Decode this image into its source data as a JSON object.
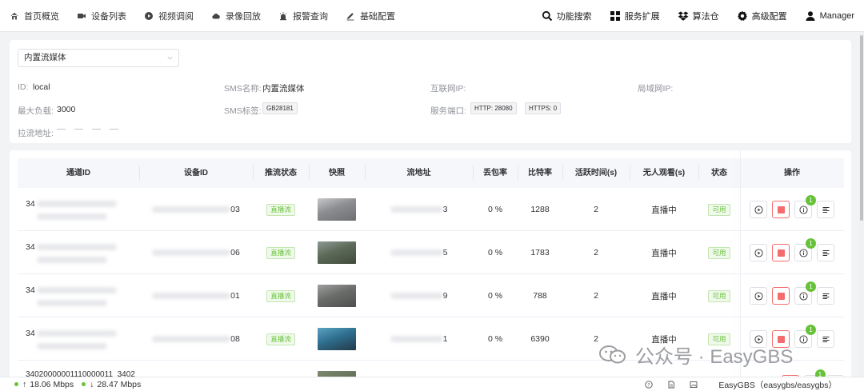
{
  "nav": {
    "left": [
      {
        "label": "首页概览",
        "icon": "home-icon"
      },
      {
        "label": "设备列表",
        "icon": "video-camera-icon"
      },
      {
        "label": "视频调阅",
        "icon": "play-circle-icon"
      },
      {
        "label": "录像回放",
        "icon": "cloud-icon"
      },
      {
        "label": "报警查询",
        "icon": "alarm-icon"
      },
      {
        "label": "基础配置",
        "icon": "edit-icon"
      }
    ],
    "right": [
      {
        "label": "功能搜索",
        "icon": "search-icon"
      },
      {
        "label": "服务扩展",
        "icon": "grid-icon"
      },
      {
        "label": "算法仓",
        "icon": "dropbox-icon"
      },
      {
        "label": "高级配置",
        "icon": "gear-icon"
      },
      {
        "label": "Manager",
        "icon": "user-icon"
      }
    ]
  },
  "server": {
    "selected": "内置流媒体",
    "id_label": "ID:",
    "id_value": "local",
    "sms_name_label": "SMS名称:",
    "sms_name_value": "内置流媒体",
    "public_ip_label": "互联网IP:",
    "lan_ip_label": "局域网IP:",
    "max_load_label": "最大负载:",
    "max_load_value": "3000",
    "sms_tag_label": "SMS标签:",
    "sms_tag_value": "GB28181",
    "port_label": "服务端口:",
    "http_port": "HTTP: 28080",
    "https_port": "HTTPS: 0",
    "pull_addr_label": "拉流地址:"
  },
  "table": {
    "headers": [
      "通道ID",
      "设备ID",
      "推流状态",
      "快照",
      "流地址",
      "丢包率",
      "比特率",
      "活跃时间(s)",
      "无人观看(s)",
      "状态",
      "操作"
    ],
    "rows": [
      {
        "channel_prefix": "34",
        "device_suffix": "03",
        "push_status": "直播流",
        "stream_suffix": "3",
        "loss": "0 %",
        "bitrate": "1288",
        "active": "2",
        "idle": "直播中",
        "status": "可用",
        "notif": "1",
        "thumb_colors": [
          "#8b8d90",
          "#c7c8ca",
          "#6e6f72"
        ]
      },
      {
        "channel_prefix": "34",
        "device_suffix": "06",
        "push_status": "直播流",
        "stream_suffix": "5",
        "loss": "0 %",
        "bitrate": "1783",
        "active": "2",
        "idle": "直播中",
        "status": "可用",
        "notif": "1",
        "thumb_colors": [
          "#5d6a58",
          "#8d9a93",
          "#3f4a3c"
        ]
      },
      {
        "channel_prefix": "34",
        "device_suffix": "01",
        "push_status": "直播流",
        "stream_suffix": "9",
        "loss": "0 %",
        "bitrate": "788",
        "active": "2",
        "idle": "直播中",
        "status": "可用",
        "notif": "1",
        "thumb_colors": [
          "#6b6d6a",
          "#9fa19e",
          "#4d4f4c"
        ]
      },
      {
        "channel_prefix": "34",
        "device_suffix": "08",
        "push_status": "直播流",
        "stream_suffix": "1",
        "loss": "0 %",
        "bitrate": "6390",
        "active": "2",
        "idle": "直播中",
        "status": "可用",
        "notif": "1",
        "thumb_colors": [
          "#2f6f8f",
          "#5aa3c2",
          "#24394a"
        ]
      }
    ],
    "partial_row_text": "34020000001110000011_3402"
  },
  "statusbar": {
    "up": "18.06 Mbps",
    "down": "28.47 Mbps",
    "brand": "EasyGBS（easygbs/easygbs）"
  },
  "watermark": {
    "text": "公众号 · EasyGBS"
  },
  "colors": {
    "accent_green": "#67c23a",
    "stop_red": "#f56c6c"
  }
}
